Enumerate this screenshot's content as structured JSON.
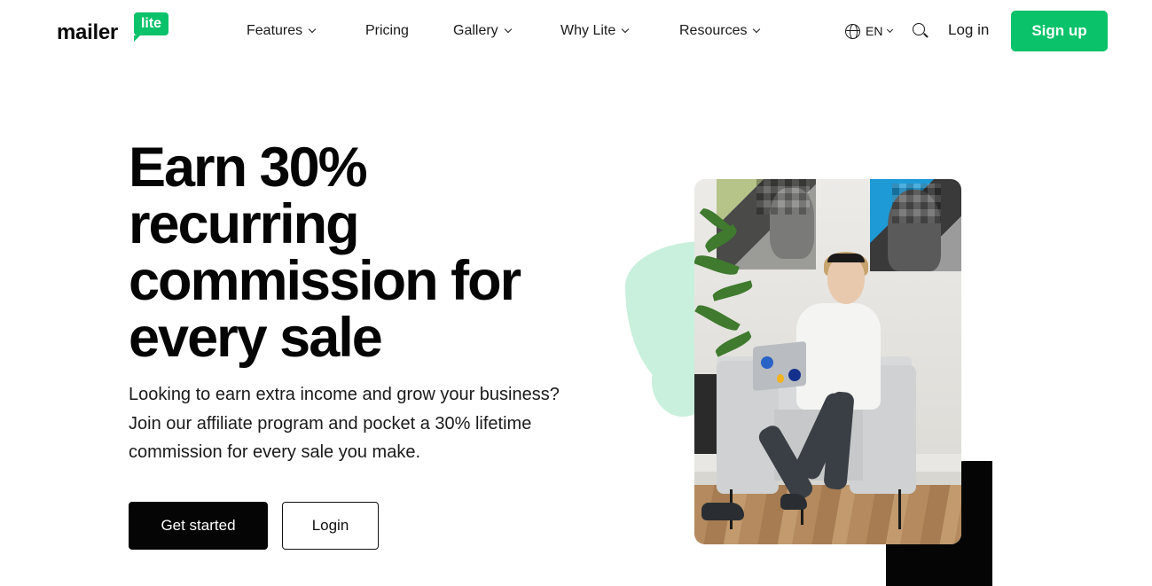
{
  "logo": {
    "word": "mailer",
    "badge": "lite"
  },
  "nav": {
    "items": [
      {
        "label": "Features",
        "dropdown": true
      },
      {
        "label": "Pricing",
        "dropdown": false
      },
      {
        "label": "Gallery",
        "dropdown": true
      },
      {
        "label": "Why Lite",
        "dropdown": true
      },
      {
        "label": "Resources",
        "dropdown": true
      }
    ]
  },
  "header": {
    "language": "EN",
    "login_label": "Log in",
    "signup_label": "Sign up"
  },
  "hero": {
    "title": "Earn 30% recurring commission for every sale",
    "subtitle": "Looking to earn extra income and grow your business? Join our affiliate program and pocket a 30% lifetime commission for every sale you make.",
    "primary_cta": "Get started",
    "secondary_cta": "Login"
  },
  "colors": {
    "brand_green": "#09c269",
    "mint_blob": "#c9f0dc",
    "text_dark": "#050505"
  }
}
